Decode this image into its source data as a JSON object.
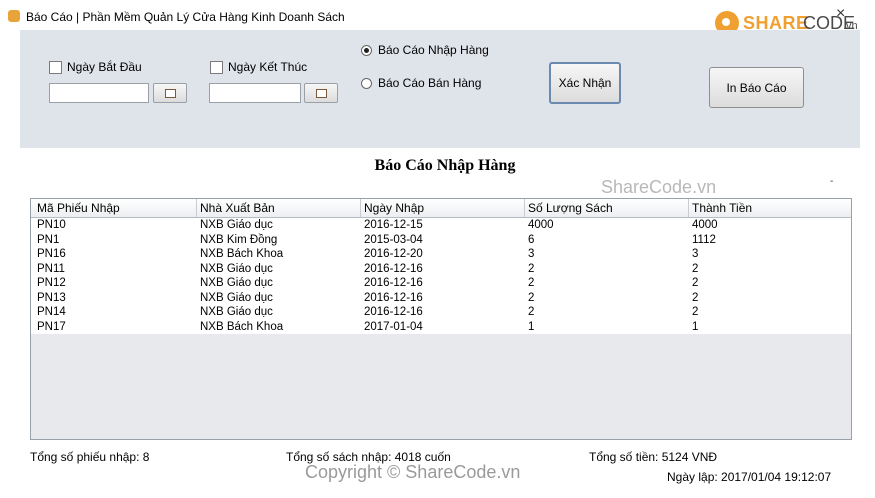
{
  "window": {
    "title": "Báo Cáo | Phần Mềm Quản Lý Cửa Hàng Kinh Doanh Sách",
    "close_glyph": "×"
  },
  "logo": {
    "share": "SHARE",
    "code": "CODE",
    "vn": ".vn"
  },
  "filters": {
    "start_date_label": "Ngày Bắt Đầu",
    "start_date_value": "",
    "end_date_label": "Ngày Kết Thúc",
    "end_date_value": "",
    "start_checked": false,
    "end_checked": false
  },
  "report_type": {
    "options": [
      {
        "label": "Báo Cáo Nhập Hàng",
        "selected": true
      },
      {
        "label": "Báo Cáo Bán Hàng",
        "selected": false
      }
    ]
  },
  "buttons": {
    "confirm": "Xác Nhận",
    "print": "In Báo Cáo"
  },
  "report": {
    "title": "Báo Cáo Nhập Hàng",
    "watermark": "ShareCode.vn",
    "dash": "-",
    "columns": [
      "Mã Phiếu Nhập",
      "Nhà Xuất Bản",
      "Ngày Nhập",
      "Số Lượng Sách",
      "Thành Tiền"
    ],
    "rows": [
      [
        "PN10",
        "NXB Giáo dục",
        "2016-12-15",
        "4000",
        "4000"
      ],
      [
        "PN1",
        "NXB Kim Đồng",
        "2015-03-04",
        "6",
        "1112"
      ],
      [
        "PN16",
        "NXB Bách Khoa",
        "2016-12-20",
        "3",
        "3"
      ],
      [
        "PN11",
        "NXB Giáo dục",
        "2016-12-16",
        "2",
        "2"
      ],
      [
        "PN12",
        "NXB Giáo dục",
        "2016-12-16",
        "2",
        "2"
      ],
      [
        "PN13",
        "NXB Giáo dục",
        "2016-12-16",
        "2",
        "2"
      ],
      [
        "PN14",
        "NXB Giáo dục",
        "2016-12-16",
        "2",
        "2"
      ],
      [
        "PN17",
        "NXB Bách Khoa",
        "2017-01-04",
        "1",
        "1"
      ]
    ]
  },
  "footer": {
    "total_receipts": "Tổng số phiếu nhập: 8",
    "total_books": "Tổng số sách nhập: 4018 cuốn",
    "total_money": "Tổng số tiền: 5124 VNĐ",
    "created": "Ngày lập: 2017/01/04 19:12:07",
    "copyright": "Copyright © ShareCode.vn"
  }
}
